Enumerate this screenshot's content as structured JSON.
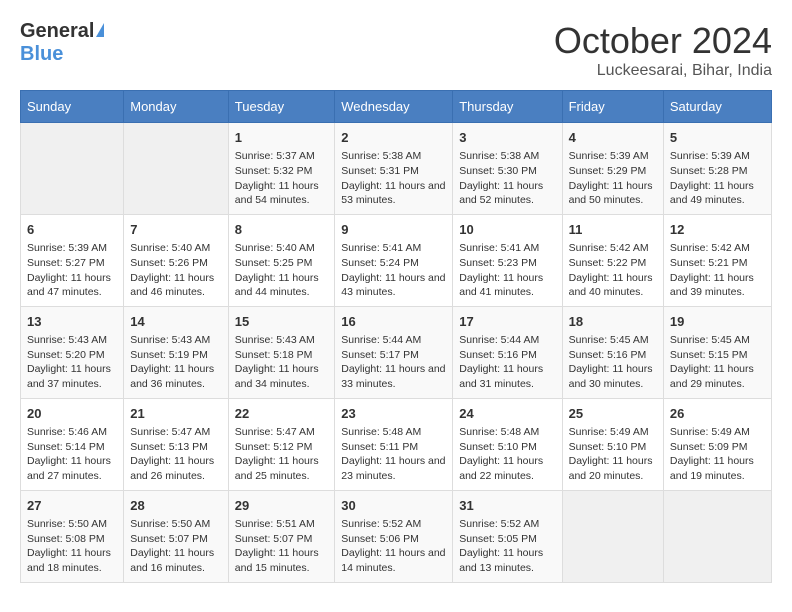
{
  "logo": {
    "general": "General",
    "blue": "Blue"
  },
  "title": {
    "month_year": "October 2024",
    "location": "Luckeesarai, Bihar, India"
  },
  "days_of_week": [
    "Sunday",
    "Monday",
    "Tuesday",
    "Wednesday",
    "Thursday",
    "Friday",
    "Saturday"
  ],
  "weeks": [
    [
      null,
      null,
      {
        "day": "1",
        "sunrise": "Sunrise: 5:37 AM",
        "sunset": "Sunset: 5:32 PM",
        "daylight": "Daylight: 11 hours and 54 minutes."
      },
      {
        "day": "2",
        "sunrise": "Sunrise: 5:38 AM",
        "sunset": "Sunset: 5:31 PM",
        "daylight": "Daylight: 11 hours and 53 minutes."
      },
      {
        "day": "3",
        "sunrise": "Sunrise: 5:38 AM",
        "sunset": "Sunset: 5:30 PM",
        "daylight": "Daylight: 11 hours and 52 minutes."
      },
      {
        "day": "4",
        "sunrise": "Sunrise: 5:39 AM",
        "sunset": "Sunset: 5:29 PM",
        "daylight": "Daylight: 11 hours and 50 minutes."
      },
      {
        "day": "5",
        "sunrise": "Sunrise: 5:39 AM",
        "sunset": "Sunset: 5:28 PM",
        "daylight": "Daylight: 11 hours and 49 minutes."
      }
    ],
    [
      {
        "day": "6",
        "sunrise": "Sunrise: 5:39 AM",
        "sunset": "Sunset: 5:27 PM",
        "daylight": "Daylight: 11 hours and 47 minutes."
      },
      {
        "day": "7",
        "sunrise": "Sunrise: 5:40 AM",
        "sunset": "Sunset: 5:26 PM",
        "daylight": "Daylight: 11 hours and 46 minutes."
      },
      {
        "day": "8",
        "sunrise": "Sunrise: 5:40 AM",
        "sunset": "Sunset: 5:25 PM",
        "daylight": "Daylight: 11 hours and 44 minutes."
      },
      {
        "day": "9",
        "sunrise": "Sunrise: 5:41 AM",
        "sunset": "Sunset: 5:24 PM",
        "daylight": "Daylight: 11 hours and 43 minutes."
      },
      {
        "day": "10",
        "sunrise": "Sunrise: 5:41 AM",
        "sunset": "Sunset: 5:23 PM",
        "daylight": "Daylight: 11 hours and 41 minutes."
      },
      {
        "day": "11",
        "sunrise": "Sunrise: 5:42 AM",
        "sunset": "Sunset: 5:22 PM",
        "daylight": "Daylight: 11 hours and 40 minutes."
      },
      {
        "day": "12",
        "sunrise": "Sunrise: 5:42 AM",
        "sunset": "Sunset: 5:21 PM",
        "daylight": "Daylight: 11 hours and 39 minutes."
      }
    ],
    [
      {
        "day": "13",
        "sunrise": "Sunrise: 5:43 AM",
        "sunset": "Sunset: 5:20 PM",
        "daylight": "Daylight: 11 hours and 37 minutes."
      },
      {
        "day": "14",
        "sunrise": "Sunrise: 5:43 AM",
        "sunset": "Sunset: 5:19 PM",
        "daylight": "Daylight: 11 hours and 36 minutes."
      },
      {
        "day": "15",
        "sunrise": "Sunrise: 5:43 AM",
        "sunset": "Sunset: 5:18 PM",
        "daylight": "Daylight: 11 hours and 34 minutes."
      },
      {
        "day": "16",
        "sunrise": "Sunrise: 5:44 AM",
        "sunset": "Sunset: 5:17 PM",
        "daylight": "Daylight: 11 hours and 33 minutes."
      },
      {
        "day": "17",
        "sunrise": "Sunrise: 5:44 AM",
        "sunset": "Sunset: 5:16 PM",
        "daylight": "Daylight: 11 hours and 31 minutes."
      },
      {
        "day": "18",
        "sunrise": "Sunrise: 5:45 AM",
        "sunset": "Sunset: 5:16 PM",
        "daylight": "Daylight: 11 hours and 30 minutes."
      },
      {
        "day": "19",
        "sunrise": "Sunrise: 5:45 AM",
        "sunset": "Sunset: 5:15 PM",
        "daylight": "Daylight: 11 hours and 29 minutes."
      }
    ],
    [
      {
        "day": "20",
        "sunrise": "Sunrise: 5:46 AM",
        "sunset": "Sunset: 5:14 PM",
        "daylight": "Daylight: 11 hours and 27 minutes."
      },
      {
        "day": "21",
        "sunrise": "Sunrise: 5:47 AM",
        "sunset": "Sunset: 5:13 PM",
        "daylight": "Daylight: 11 hours and 26 minutes."
      },
      {
        "day": "22",
        "sunrise": "Sunrise: 5:47 AM",
        "sunset": "Sunset: 5:12 PM",
        "daylight": "Daylight: 11 hours and 25 minutes."
      },
      {
        "day": "23",
        "sunrise": "Sunrise: 5:48 AM",
        "sunset": "Sunset: 5:11 PM",
        "daylight": "Daylight: 11 hours and 23 minutes."
      },
      {
        "day": "24",
        "sunrise": "Sunrise: 5:48 AM",
        "sunset": "Sunset: 5:10 PM",
        "daylight": "Daylight: 11 hours and 22 minutes."
      },
      {
        "day": "25",
        "sunrise": "Sunrise: 5:49 AM",
        "sunset": "Sunset: 5:10 PM",
        "daylight": "Daylight: 11 hours and 20 minutes."
      },
      {
        "day": "26",
        "sunrise": "Sunrise: 5:49 AM",
        "sunset": "Sunset: 5:09 PM",
        "daylight": "Daylight: 11 hours and 19 minutes."
      }
    ],
    [
      {
        "day": "27",
        "sunrise": "Sunrise: 5:50 AM",
        "sunset": "Sunset: 5:08 PM",
        "daylight": "Daylight: 11 hours and 18 minutes."
      },
      {
        "day": "28",
        "sunrise": "Sunrise: 5:50 AM",
        "sunset": "Sunset: 5:07 PM",
        "daylight": "Daylight: 11 hours and 16 minutes."
      },
      {
        "day": "29",
        "sunrise": "Sunrise: 5:51 AM",
        "sunset": "Sunset: 5:07 PM",
        "daylight": "Daylight: 11 hours and 15 minutes."
      },
      {
        "day": "30",
        "sunrise": "Sunrise: 5:52 AM",
        "sunset": "Sunset: 5:06 PM",
        "daylight": "Daylight: 11 hours and 14 minutes."
      },
      {
        "day": "31",
        "sunrise": "Sunrise: 5:52 AM",
        "sunset": "Sunset: 5:05 PM",
        "daylight": "Daylight: 11 hours and 13 minutes."
      },
      null,
      null
    ]
  ]
}
